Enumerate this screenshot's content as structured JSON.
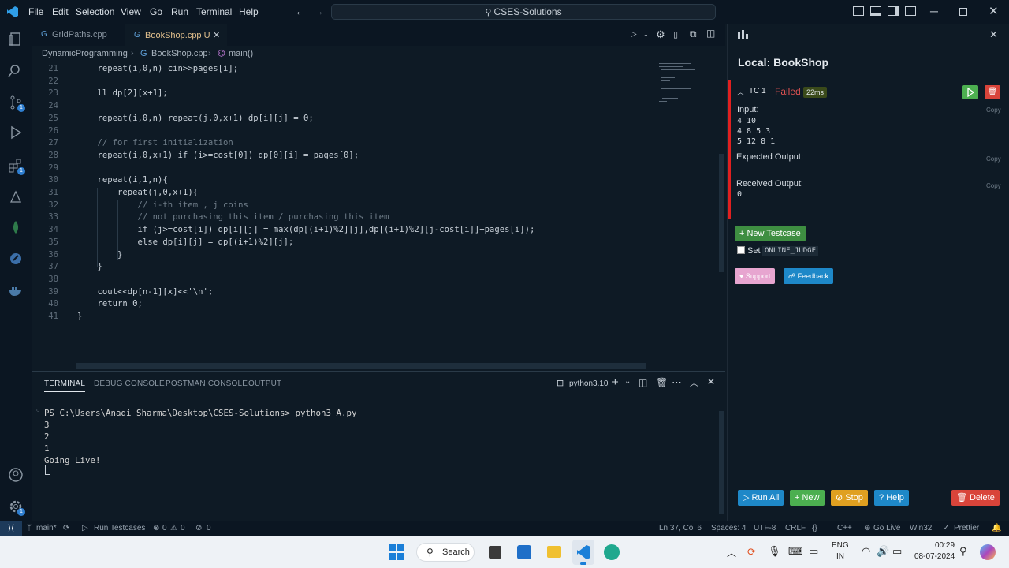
{
  "menu": {
    "file": "File",
    "edit": "Edit",
    "selection": "Selection",
    "view": "View",
    "go": "Go",
    "run": "Run",
    "terminal": "Terminal",
    "help": "Help"
  },
  "search_text": "CSES-Solutions",
  "tabs": [
    {
      "label": "GridPaths.cpp"
    },
    {
      "label": "BookShop.cpp U"
    }
  ],
  "breadcrumb": {
    "folder": "DynamicProgramming",
    "file": "BookShop.cpp",
    "symbol": "main()"
  },
  "code_lines": [
    {
      "n": "21",
      "t": "    repeat(i,0,n) cin>>pages[i];"
    },
    {
      "n": "22",
      "t": ""
    },
    {
      "n": "23",
      "t": "    ll dp[2][x+1];"
    },
    {
      "n": "24",
      "t": ""
    },
    {
      "n": "25",
      "t": "    repeat(i,0,n) repeat(j,0,x+1) dp[i][j] = 0;"
    },
    {
      "n": "26",
      "t": ""
    },
    {
      "n": "27",
      "t": "    // for first initialization"
    },
    {
      "n": "28",
      "t": "    repeat(i,0,x+1) if (i>=cost[0]) dp[0][i] = pages[0];"
    },
    {
      "n": "29",
      "t": ""
    },
    {
      "n": "30",
      "t": "    repeat(i,1,n){"
    },
    {
      "n": "31",
      "t": "        repeat(j,0,x+1){"
    },
    {
      "n": "32",
      "t": "            // i-th item , j coins"
    },
    {
      "n": "33",
      "t": "            // not purchasing this item / purchasing this item"
    },
    {
      "n": "34",
      "t": "            if (j>=cost[i]) dp[i][j] = max(dp[(i+1)%2][j],dp[(i+1)%2][j-cost[i]]+pages[i]);"
    },
    {
      "n": "35",
      "t": "            else dp[i][j] = dp[(i+1)%2][j];"
    },
    {
      "n": "36",
      "t": "        }"
    },
    {
      "n": "37",
      "t": "    }"
    },
    {
      "n": "38",
      "t": ""
    },
    {
      "n": "39",
      "t": "    cout<<dp[n-1][x]<<'\\n';"
    },
    {
      "n": "40",
      "t": "    return 0;"
    },
    {
      "n": "41",
      "t": "}"
    }
  ],
  "panel": {
    "tabs": [
      "TERMINAL",
      "DEBUG CONSOLE",
      "POSTMAN CONSOLE",
      "OUTPUT"
    ],
    "shell": "python3.10",
    "lines": [
      "PS C:\\Users\\Anadi Sharma\\Desktop\\CSES-Solutions> python3 A.py",
      "3",
      "2",
      "1",
      "Going Live!"
    ]
  },
  "cph": {
    "title": "Local: BookShop",
    "tc_label": "TC 1",
    "status": "Failed",
    "time": "22ms",
    "input_label": "Input:",
    "input_lines": [
      "4 10",
      "4 8 5 3",
      "5 12 8 1"
    ],
    "expected_label": "Expected Output:",
    "received_label": "Received Output:",
    "received": "0",
    "copy": "Copy",
    "new_testcase": "New Testcase",
    "set_label": "Set",
    "online_judge": "ONLINE_JUDGE",
    "support": "Support",
    "feedback": "Feedback",
    "run_all": "Run All",
    "new": "New",
    "stop": "Stop",
    "help": "Help",
    "delete": "Delete",
    "colors": {
      "failed": "#e05252",
      "green": "#4caf50",
      "blue": "#1e88c8",
      "orange": "#e0a020",
      "red": "#d9443a"
    }
  },
  "status": {
    "branch": "main*",
    "run_testcases": "Run Testcases",
    "errors": "0",
    "warnings": "0",
    "ports": "0",
    "position": "Ln 37, Col 6",
    "spaces": "Spaces: 4",
    "encoding": "UTF-8",
    "eol": "CRLF",
    "lang": "C++",
    "golive": "Go Live",
    "platform": "Win32",
    "prettier": "Prettier"
  },
  "taskbar": {
    "search": "Search",
    "lang1": "ENG",
    "lang2": "IN",
    "time": "00:29",
    "date": "08-07-2024"
  }
}
